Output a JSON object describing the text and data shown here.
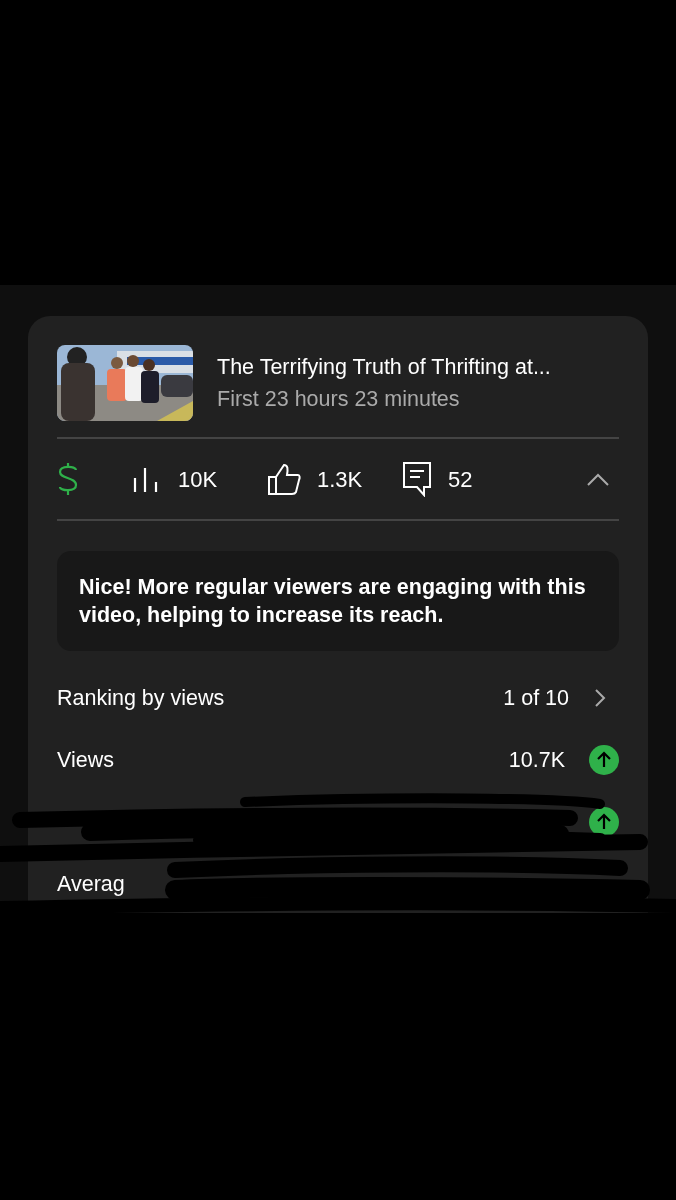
{
  "video": {
    "title": "The Terrifying Truth of Thrifting at...",
    "subtitle": "First 23 hours 23 minutes"
  },
  "stats": [
    {
      "kind": "revenue"
    },
    {
      "kind": "views",
      "value": "10K"
    },
    {
      "kind": "likes",
      "value": "1.3K"
    },
    {
      "kind": "comments",
      "value": "52"
    }
  ],
  "stats_expanded": true,
  "message": "Nice! More regular viewers are engaging with this video, helping to increase its reach.",
  "metrics": [
    {
      "kind": "link",
      "label": "Ranking by views",
      "value": "1 of 10"
    },
    {
      "kind": "trend",
      "label": "Views",
      "value": "10.7K",
      "rising": true
    },
    {
      "kind": "trend",
      "rising": true
    },
    {
      "kind": "plain",
      "label": "Averag"
    }
  ]
}
